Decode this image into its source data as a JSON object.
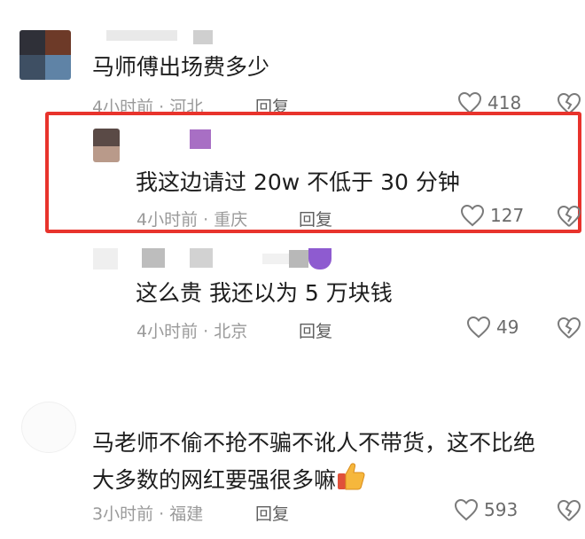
{
  "comments": [
    {
      "text": "马师傅出场费多少",
      "time": "4小时前",
      "location": "河北",
      "reply_label": "回复",
      "likes": "418"
    },
    {
      "text": "我这边请过 20w 不低于 30 分钟",
      "time": "4小时前",
      "location": "重庆",
      "reply_label": "回复",
      "likes": "127"
    },
    {
      "text": "这么贵 我还以为 5 万块钱",
      "time": "4小时前",
      "location": "北京",
      "reply_label": "回复",
      "likes": "49"
    },
    {
      "text_line1": "马老师不偷不抢不骗不讹人不带货，这不比绝",
      "text_line2": "大多数的网红要强很多嘛",
      "time": "3小时前",
      "location": "福建",
      "reply_label": "回复",
      "likes": "593"
    }
  ],
  "meta_separator": " · ",
  "colors": {
    "highlight": "#e8332c",
    "meta": "#9a9a9a",
    "text": "#1d1d1d"
  },
  "icons": {
    "like": "heart-outline-icon",
    "dislike": "broken-heart-icon",
    "emoji": "thumbs-up-emoji-icon"
  }
}
